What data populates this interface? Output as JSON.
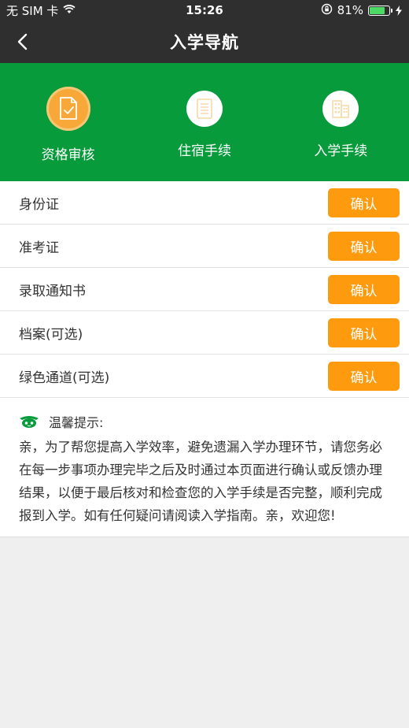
{
  "status_bar": {
    "carrier": "无 SIM 卡",
    "time": "15:26",
    "battery": "81%",
    "battery_level": 0.81,
    "battery_color": "#4cd964"
  },
  "nav": {
    "title": "入学导航",
    "back_icon": "chevron-left-icon"
  },
  "steps": [
    {
      "label": "资格审核",
      "icon": "document-check-icon",
      "active": true
    },
    {
      "label": "住宿手续",
      "icon": "list-document-icon",
      "active": false
    },
    {
      "label": "入学手续",
      "icon": "building-icon",
      "active": false
    }
  ],
  "items": [
    {
      "label": "身份证",
      "button": "确认"
    },
    {
      "label": "准考证",
      "button": "确认"
    },
    {
      "label": "录取通知书",
      "button": "确认"
    },
    {
      "label": "档案(可选)",
      "button": "确认"
    },
    {
      "label": "绿色通道(可选)",
      "button": "确认"
    }
  ],
  "tips": {
    "title": "温馨提示:",
    "body": "亲，为了帮您提高入学效率，避免遗漏入学办理环节，请您务必在每一步事项办理完毕之后及时通过本页面进行确认或反馈办理结果，以便于最后核对和检查您的入学手续是否完整，顺利完成报到入学。如有任何疑问请阅读入学指南。亲，欢迎您!"
  },
  "colors": {
    "header_bg": "#2f2f2f",
    "steps_bg": "#079b3b",
    "accent": "#fe9a0d"
  }
}
